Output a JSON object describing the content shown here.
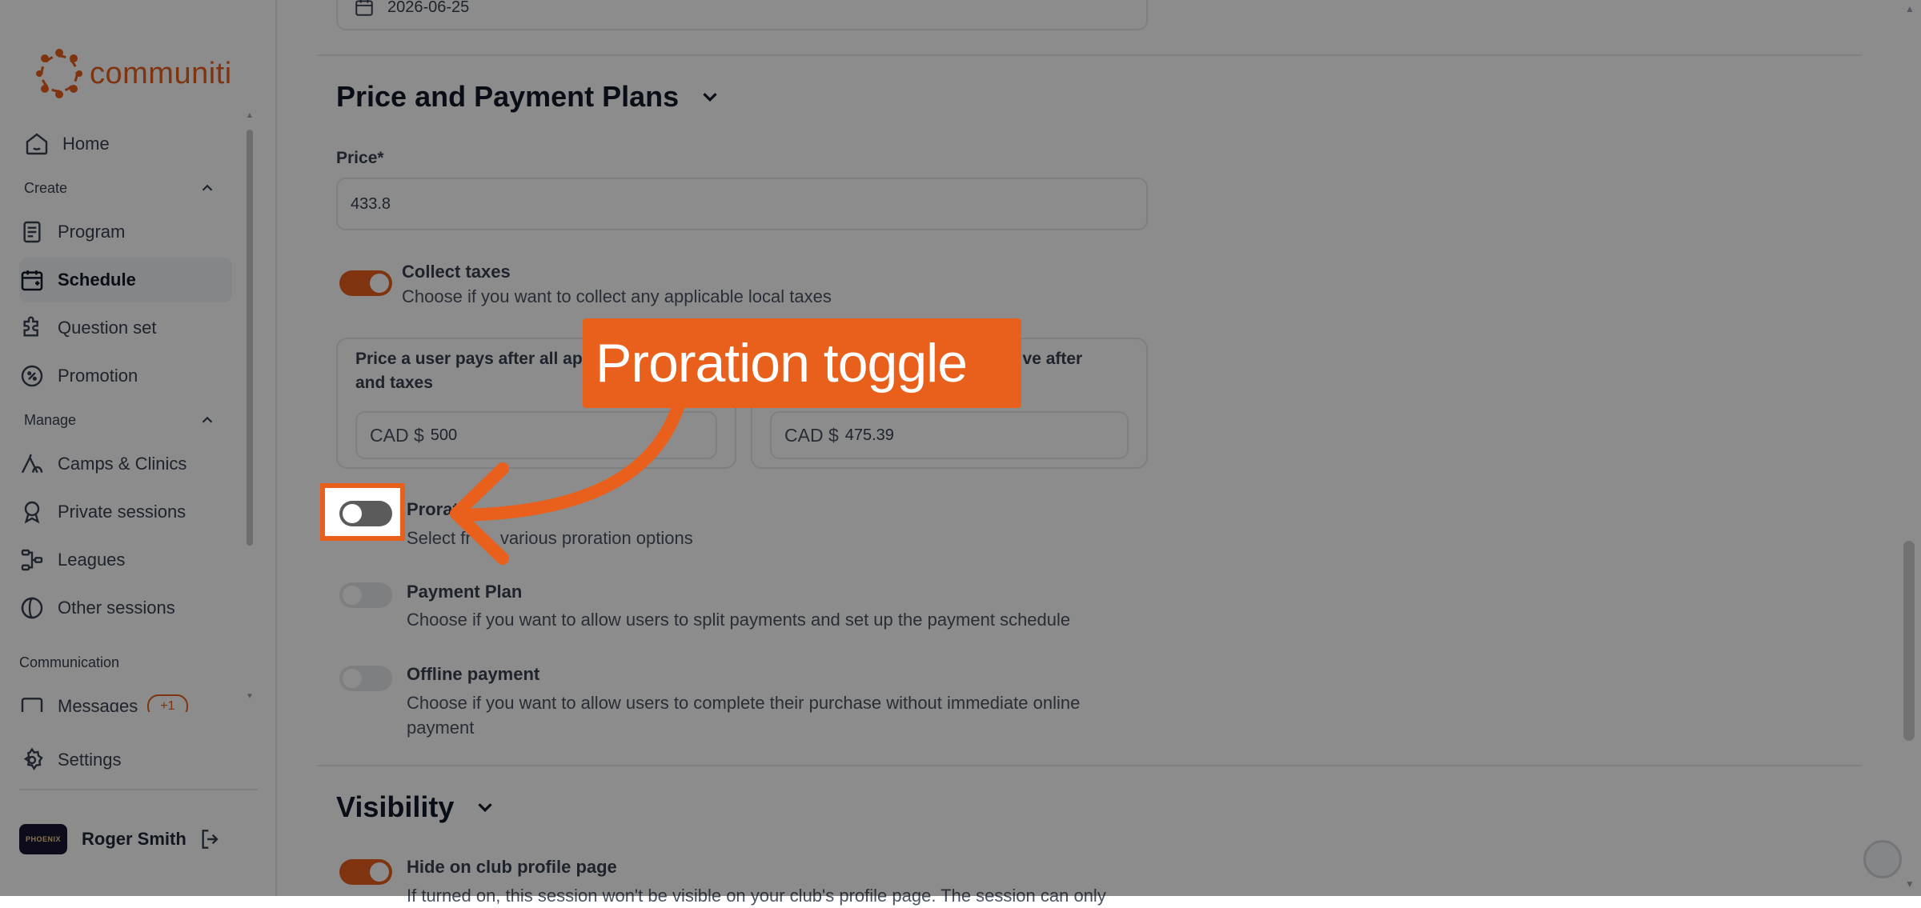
{
  "brand": {
    "name": "communiti",
    "color": "#e8601c"
  },
  "sidebar": {
    "home": "Home",
    "create_label": "Create",
    "create_items": [
      {
        "label": "Program",
        "icon": "document-icon"
      },
      {
        "label": "Schedule",
        "icon": "calendar-icon"
      },
      {
        "label": "Question set",
        "icon": "puzzle-icon"
      },
      {
        "label": "Promotion",
        "icon": "discount-icon"
      }
    ],
    "manage_label": "Manage",
    "manage_items": [
      {
        "label": "Camps & Clinics",
        "icon": "tent-icon"
      },
      {
        "label": "Private sessions",
        "icon": "award-icon"
      },
      {
        "label": "Leagues",
        "icon": "bracket-icon"
      },
      {
        "label": "Other sessions",
        "icon": "half-circle-icon"
      }
    ],
    "communication_label": "Communication",
    "messages_label": "Messages",
    "messages_badge": "+1",
    "settings": "Settings",
    "user_name": "Roger Smith",
    "avatar_text": "PHOENIX"
  },
  "form": {
    "date_value": "2026-06-25",
    "price_section_title": "Price and Payment Plans",
    "price_label": "Price*",
    "price_value": "433.8",
    "collect_taxes_title": "Collect taxes",
    "collect_taxes_desc": "Choose if you want to collect any applicable local taxes",
    "user_pays_label": "Price a user pays after all ap",
    "user_pays_label_2": "and taxes",
    "user_pays_currency": "CAD $",
    "user_pays_value": "500",
    "receive_label": "eive after",
    "receive_currency": "CAD $",
    "receive_value": "475.39",
    "proration_title": "Prorat",
    "proration_desc": "Select fr",
    "proration_desc_2": " various proration options",
    "payment_plan_title": "Payment Plan",
    "payment_plan_desc": "Choose if you want to allow users to split payments and set up the payment schedule",
    "offline_title": "Offline payment",
    "offline_desc_1": "Choose if you want to allow users to complete their purchase without immediate online",
    "offline_desc_2": "payment",
    "visibility_title": "Visibility",
    "hide_title": "Hide on club profile page",
    "hide_desc": "If turned on, this session won't be visible on your club's profile page. The session can only"
  },
  "annotation": {
    "callout_text": "Proration toggle"
  }
}
